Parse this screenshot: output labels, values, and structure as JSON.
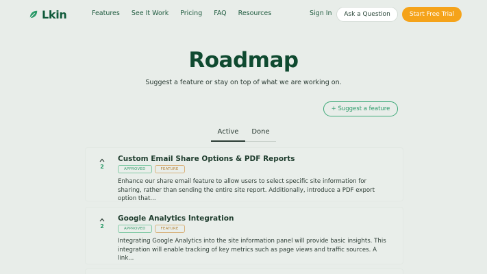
{
  "brand": {
    "name": "Lkin",
    "accent": "#2a9a68",
    "primary_dark": "#0f5a3a",
    "cta": "#f5a31a"
  },
  "nav": {
    "links": [
      "Features",
      "See It Work",
      "Pricing",
      "FAQ",
      "Resources"
    ],
    "signin": "Sign In",
    "ask": "Ask a Question",
    "trial": "Start Free Trial"
  },
  "hero": {
    "title": "Roadmap",
    "subtitle": "Suggest a feature or stay on top of what we are working on.",
    "suggest_button": "+ Suggest a feature"
  },
  "tabs": {
    "active": "Active",
    "done": "Done"
  },
  "items": [
    {
      "votes": "2",
      "title": "Custom Email Share Options & PDF Reports",
      "status": "APPROVED",
      "type": "FEATURE",
      "description": "Enhance our share email feature to allow users to select specific site information for sharing, rather than sending the entire site report. Additionally, introduce a PDF export option that..."
    },
    {
      "votes": "2",
      "title": "Google Analytics Integration",
      "status": "APPROVED",
      "type": "FEATURE",
      "description": "Integrating Google Analytics into the site information panel will provide basic insights. This integration will enable tracking of key metrics such as page views and traffic sources. A link..."
    }
  ],
  "icons": {
    "logo": "leaf-icon",
    "upvote": "chevron-up-icon"
  }
}
